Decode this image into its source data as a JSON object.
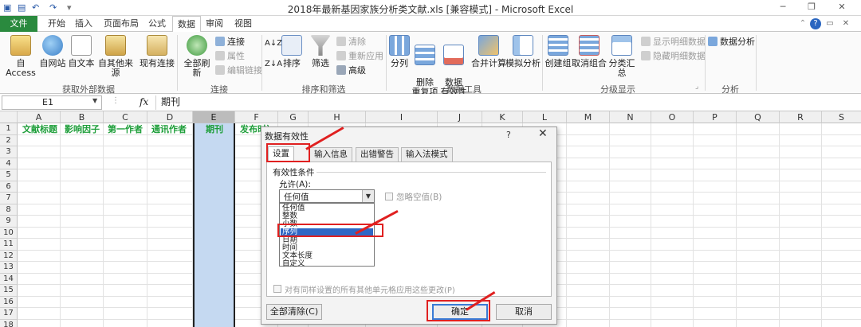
{
  "window": {
    "title": "2018年最新基因家族分析类文献.xls  [兼容模式] - Microsoft Excel"
  },
  "tabs": {
    "file": "文件",
    "items": [
      "开始",
      "插入",
      "页面布局",
      "公式",
      "数据",
      "审阅",
      "视图"
    ],
    "active": "数据"
  },
  "ribbon": {
    "get_external": {
      "label": "获取外部数据",
      "buttons": [
        "自 Access",
        "自网站",
        "自文本",
        "自其他来源",
        "现有连接"
      ]
    },
    "connections": {
      "label": "连接",
      "refresh_all": "全部刷新",
      "small": [
        "连接",
        "属性",
        "编辑链接"
      ]
    },
    "sort_filter": {
      "label": "排序和筛选",
      "sort": "排序",
      "filter": "筛选",
      "small": [
        "清除",
        "重新应用",
        "高级"
      ]
    },
    "data_tools": {
      "label": "数据工具",
      "buttons": [
        "分列",
        "删除\n重复项",
        "数据\n有效性",
        "合并计算",
        "模拟分析"
      ]
    },
    "outline": {
      "label": "分级显示",
      "buttons": [
        "创建组",
        "取消组合",
        "分类汇总"
      ],
      "small": [
        "显示明细数据",
        "隐藏明细数据"
      ]
    },
    "analysis": {
      "label": "分析",
      "button": "数据分析"
    }
  },
  "formula_bar": {
    "name_box": "E1",
    "fx": "fx",
    "content": "期刊"
  },
  "grid": {
    "columns": [
      "A",
      "B",
      "C",
      "D",
      "E",
      "F",
      "G",
      "H",
      "I",
      "J",
      "K",
      "L",
      "M",
      "N",
      "O",
      "P",
      "Q",
      "R",
      "S"
    ],
    "selected_column": "E",
    "rows": [
      "1",
      "2",
      "3",
      "4",
      "5",
      "6",
      "7",
      "8",
      "9",
      "10",
      "11",
      "12",
      "13",
      "14",
      "15",
      "16",
      "17",
      "18"
    ],
    "row1": [
      "文献标题",
      "影响因子",
      "第一作者",
      "通讯作者",
      "期刊",
      "发布时间"
    ]
  },
  "dialog": {
    "title": "数据有效性",
    "help": "?",
    "tabs": [
      "设置",
      "输入信息",
      "出错警告",
      "输入法模式"
    ],
    "section": "有效性条件",
    "allow_label": "允许(A):",
    "allow_value": "任何值",
    "ignore_blank": "忽略空值(B)",
    "options": [
      "任何值",
      "整数",
      "小数",
      "序列",
      "日期",
      "时间",
      "文本长度",
      "自定义"
    ],
    "selected_option": "序列",
    "apply_all": "对有同样设置的所有其他单元格应用这些更改(P)",
    "clear_all": "全部清除(C)",
    "ok": "确定",
    "cancel": "取消"
  },
  "colors": {
    "file_tab": "#2a8a3e",
    "header_text": "#1e9e3a",
    "column_selection": "#c5d9f1",
    "list_selection": "#2f67c5",
    "annotation": "#e02020"
  }
}
